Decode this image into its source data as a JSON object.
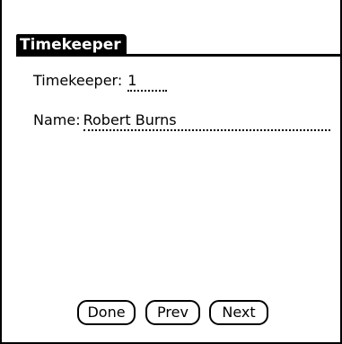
{
  "form": {
    "title": "Timekeeper"
  },
  "fields": {
    "timekeeper": {
      "label": "Timekeeper:",
      "value": "1"
    },
    "name": {
      "label": "Name:",
      "value": "Robert Burns"
    }
  },
  "buttons": {
    "done": "Done",
    "prev": "Prev",
    "next": "Next"
  }
}
